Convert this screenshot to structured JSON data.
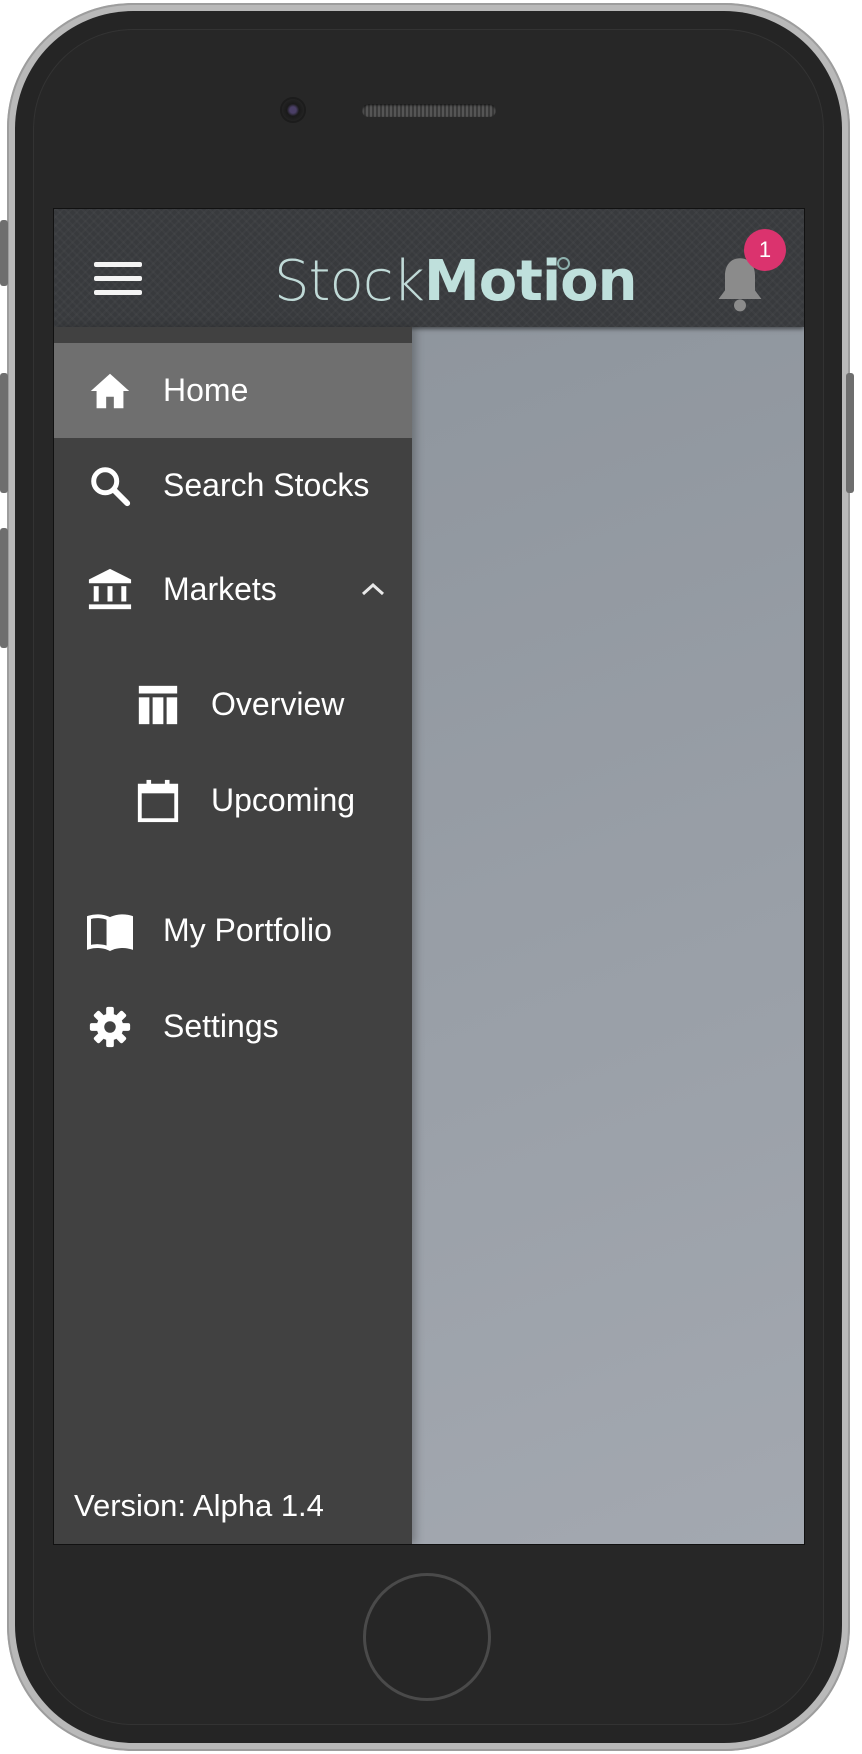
{
  "app": {
    "logo_light": "Stock",
    "logo_bold": "Motion",
    "notification_count": "1"
  },
  "drawer": {
    "items": [
      {
        "label": "Home",
        "icon": "home-icon",
        "active": true
      },
      {
        "label": "Search Stocks",
        "icon": "search-icon"
      },
      {
        "label": "Markets",
        "icon": "bank-icon",
        "expanded": true,
        "children": [
          {
            "label": "Overview",
            "icon": "table-icon"
          },
          {
            "label": "Upcoming",
            "icon": "calendar-icon"
          }
        ]
      },
      {
        "label": "My Portfolio",
        "icon": "book-icon"
      },
      {
        "label": "Settings",
        "icon": "gear-icon"
      }
    ],
    "version": "Version: Alpha 1.4"
  },
  "colors": {
    "header_bg": "#383a3d",
    "drawer_bg": "#414141",
    "active_item_bg": "#6f6f6f",
    "logo": "#bfe0dc",
    "badge": "#db336e",
    "content_bg": "#8e959e"
  }
}
